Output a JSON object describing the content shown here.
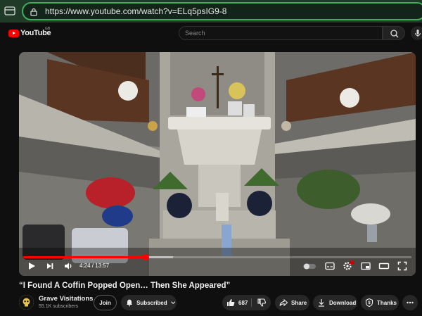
{
  "browser": {
    "url": "https://www.youtube.com/watch?v=ELq5psIG9-8"
  },
  "header": {
    "logo_text": "YouTube",
    "region": "GB",
    "search_placeholder": "Search"
  },
  "player": {
    "current_time": "4:24",
    "duration": "13:57",
    "time_display": "4:24 / 13:57",
    "progress_fraction": 0.316,
    "buffer_fraction": 0.385,
    "captions_badge": "HD"
  },
  "video": {
    "title": "“I Found A Coffin Popped Open… Then She Appeared”"
  },
  "channel": {
    "name": "Grave Visitations",
    "subscribers": "55.1K subscribers",
    "join_label": "Join",
    "subscribed_label": "Subscribed"
  },
  "actions": {
    "likes": "687",
    "share_label": "Share",
    "download_label": "Download",
    "thanks_label": "Thanks"
  },
  "colors": {
    "accent": "#ff0000",
    "browser_bar": "#1f3a26",
    "url_border": "#3fae5a",
    "page_bg": "#0f0f0f",
    "button_bg": "#272727"
  }
}
